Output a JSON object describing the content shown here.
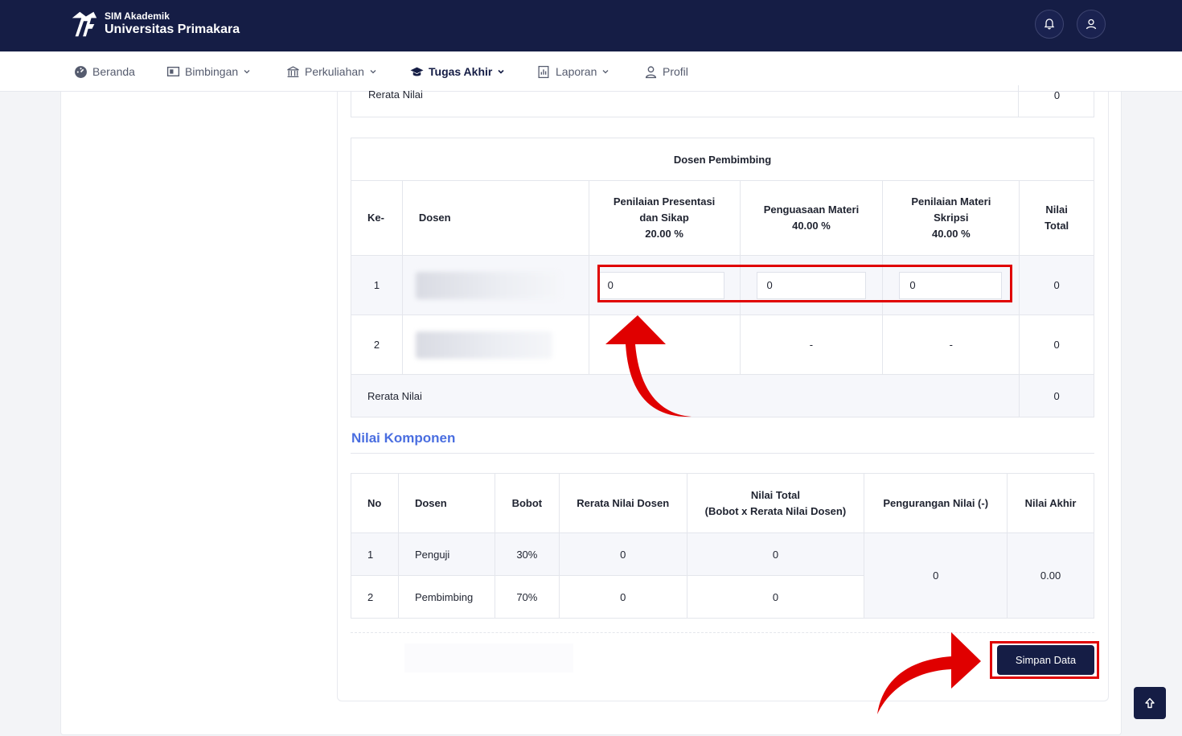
{
  "header": {
    "subtitle": "SIM Akademik",
    "title": "Universitas Primakara",
    "notification_icon": "bell-icon",
    "profile_icon": "user-icon"
  },
  "nav": {
    "items": [
      {
        "label": "Beranda",
        "icon": "dashboard-icon"
      },
      {
        "label": "Bimbingan",
        "icon": "board-icon"
      },
      {
        "label": "Perkuliahan",
        "icon": "building-icon"
      },
      {
        "label": "Tugas Akhir",
        "icon": "graduation-cap-icon"
      },
      {
        "label": "Laporan",
        "icon": "report-icon"
      },
      {
        "label": "Profil",
        "icon": "user-icon"
      }
    ]
  },
  "previous_table": {
    "avg_label": "Rerata Nilai",
    "avg_value": "0"
  },
  "pembimbing_table": {
    "caption": "Dosen Pembimbing",
    "headers": {
      "ke": "Ke-",
      "dosen": "Dosen",
      "c1_name": "Penilaian Presentasi dan Sikap",
      "c1_weight": "20.00 %",
      "c2_name": "Penguasaan Materi",
      "c2_weight": "40.00 %",
      "c3_name": "Penilaian Materi Skripsi",
      "c3_weight": "40.00 %",
      "total": "Nilai Total"
    },
    "rows": [
      {
        "no": "1",
        "c1": "0",
        "c2": "0",
        "c3": "0",
        "total": "0"
      },
      {
        "no": "2",
        "c1": "",
        "c2": "-",
        "c3": "-",
        "total": "0"
      }
    ],
    "avg_label": "Rerata Nilai",
    "avg_value": "0"
  },
  "komponen": {
    "title": "Nilai Komponen",
    "headers": {
      "no": "No",
      "dosen": "Dosen",
      "bobot": "Bobot",
      "rerata": "Rerata Nilai Dosen",
      "total_line1": "Nilai Total",
      "total_line2": "(Bobot x Rerata Nilai Dosen)",
      "pengurangan": "Pengurangan Nilai (-)",
      "akhir": "Nilai Akhir"
    },
    "rows": [
      {
        "no": "1",
        "dosen": "Penguji",
        "bobot": "30%",
        "rerata": "0",
        "total": "0"
      },
      {
        "no": "2",
        "dosen": "Pembimbing",
        "bobot": "70%",
        "rerata": "0",
        "total": "0"
      }
    ],
    "pengurangan": "0",
    "akhir": "0.00"
  },
  "actions": {
    "save_label": "Simpan Data",
    "scroll_top_icon": "arrow-up-icon"
  },
  "colors": {
    "navy": "#151d45",
    "accent_blue": "#4a6ee0",
    "annotation_red": "#e00000"
  }
}
